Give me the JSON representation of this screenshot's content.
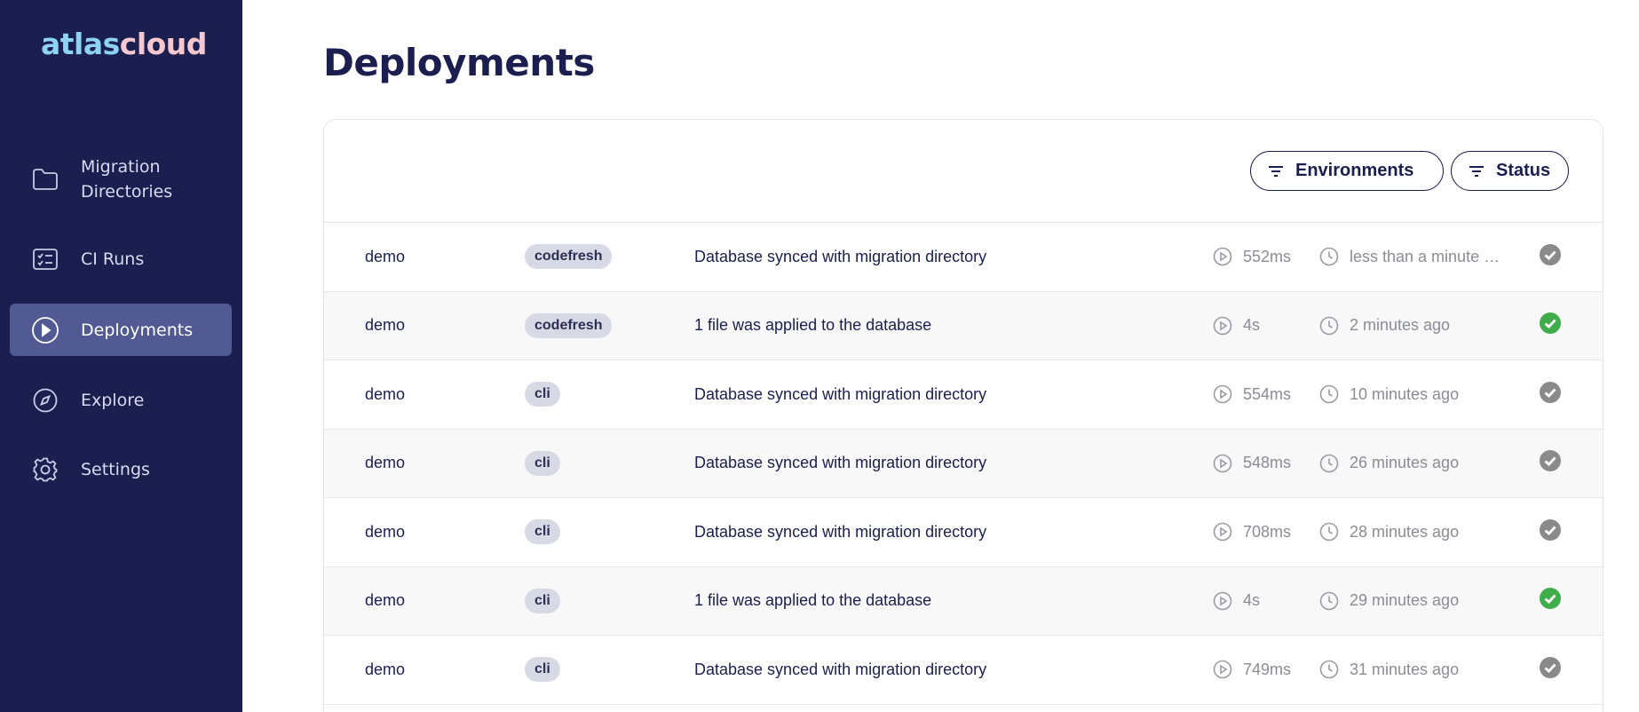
{
  "app": {
    "logo_part1": "atlas",
    "logo_part2": "cloud"
  },
  "sidebar": {
    "items": [
      {
        "label_line1": "Migration",
        "label_line2": "Directories",
        "icon": "folder-icon",
        "active": false
      },
      {
        "label": "CI Runs",
        "icon": "checklist-icon",
        "active": false
      },
      {
        "label": "Deployments",
        "icon": "play-circle-icon",
        "active": true
      },
      {
        "label": "Explore",
        "icon": "compass-icon",
        "active": false
      },
      {
        "label": "Settings",
        "icon": "gear-icon",
        "active": false
      }
    ]
  },
  "main": {
    "title": "Deployments",
    "filters": {
      "environments_label": "Environments",
      "status_label": "Status"
    },
    "deployments": [
      {
        "env": "demo",
        "tag": "codefresh",
        "message": "Database synced with migration directory",
        "duration": "552ms",
        "time": "less than a minute ago",
        "status": "synced"
      },
      {
        "env": "demo",
        "tag": "codefresh",
        "message": "1 file was applied to the database",
        "duration": "4s",
        "time": "2 minutes ago",
        "status": "applied"
      },
      {
        "env": "demo",
        "tag": "cli",
        "message": "Database synced with migration directory",
        "duration": "554ms",
        "time": "10 minutes ago",
        "status": "synced"
      },
      {
        "env": "demo",
        "tag": "cli",
        "message": "Database synced with migration directory",
        "duration": "548ms",
        "time": "26 minutes ago",
        "status": "synced"
      },
      {
        "env": "demo",
        "tag": "cli",
        "message": "Database synced with migration directory",
        "duration": "708ms",
        "time": "28 minutes ago",
        "status": "synced"
      },
      {
        "env": "demo",
        "tag": "cli",
        "message": "1 file was applied to the database",
        "duration": "4s",
        "time": "29 minutes ago",
        "status": "applied"
      },
      {
        "env": "demo",
        "tag": "cli",
        "message": "Database synced with migration directory",
        "duration": "749ms",
        "time": "31 minutes ago",
        "status": "synced"
      }
    ]
  },
  "colors": {
    "sidebar_bg": "#1b1f4f",
    "active_item_bg": "#515a92",
    "status_applied": "#3fae4a",
    "status_synced": "#8a8a8a"
  }
}
